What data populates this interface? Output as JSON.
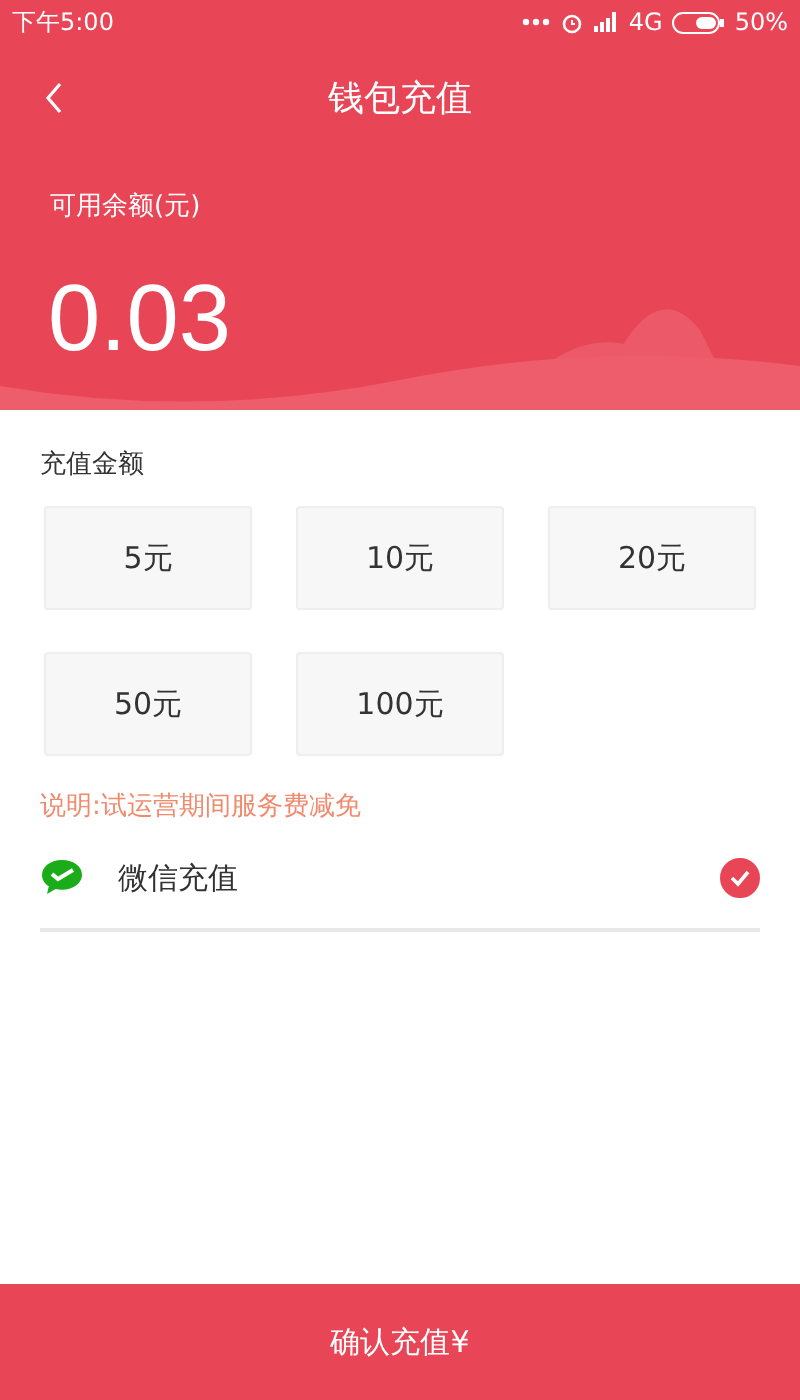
{
  "status_bar": {
    "time": "下午5:00",
    "network": "4G",
    "battery": "50%"
  },
  "header": {
    "title": "钱包充值"
  },
  "balance": {
    "label": "可用余额(元)",
    "amount": "0.03"
  },
  "recharge": {
    "label": "充值金额",
    "amounts": [
      {
        "label": "5元",
        "selected": false
      },
      {
        "label": "10元",
        "selected": false
      },
      {
        "label": "20元",
        "selected": false
      },
      {
        "label": "50元",
        "selected": false
      },
      {
        "label": "100元",
        "selected": false
      }
    ],
    "note": "说明:试运营期间服务费减免"
  },
  "payment_methods": [
    {
      "label": "微信充值",
      "checked": true
    }
  ],
  "confirm_button": "确认充值¥"
}
